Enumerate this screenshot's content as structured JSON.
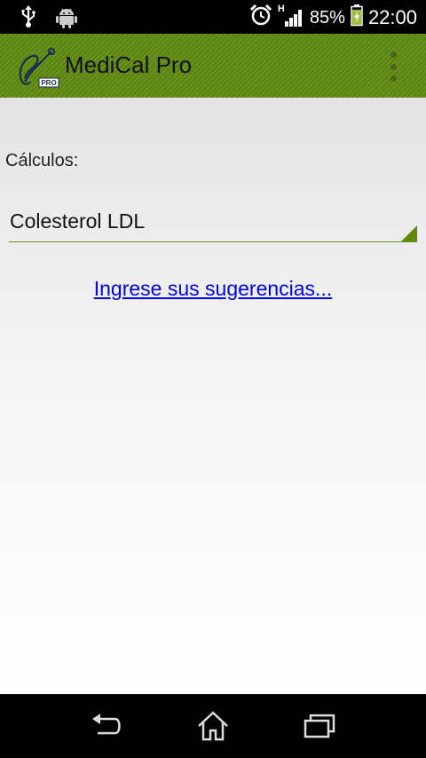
{
  "status_bar": {
    "battery_percent": "85%",
    "time": "22:00",
    "network_type": "H",
    "icons": [
      "usb-icon",
      "android-debug-icon",
      "alarm-icon",
      "signal-icon",
      "battery-charging-icon"
    ]
  },
  "action_bar": {
    "title": "MediCal Pro",
    "logo_badge": "PRO",
    "color": "#5f8a10"
  },
  "main": {
    "calculos_label": "Cálculos:",
    "spinner_value": "Colesterol LDL",
    "suggest_link": "Ingrese sus sugerencias..."
  },
  "nav_bar": {
    "icons": [
      "back-icon",
      "home-icon",
      "recent-apps-icon"
    ]
  }
}
